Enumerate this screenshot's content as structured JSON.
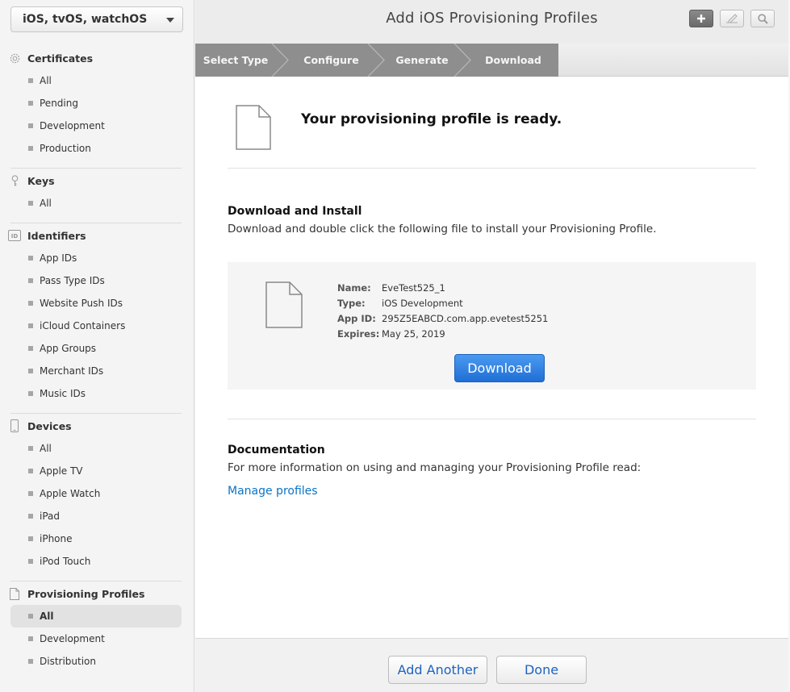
{
  "sidebar": {
    "platform": "iOS, tvOS, watchOS",
    "sections": {
      "certificates": {
        "title": "Certificates",
        "items": [
          "All",
          "Pending",
          "Development",
          "Production"
        ]
      },
      "keys": {
        "title": "Keys",
        "items": [
          "All"
        ]
      },
      "identifiers": {
        "title": "Identifiers",
        "items": [
          "App IDs",
          "Pass Type IDs",
          "Website Push IDs",
          "iCloud Containers",
          "App Groups",
          "Merchant IDs",
          "Music IDs"
        ]
      },
      "devices": {
        "title": "Devices",
        "items": [
          "All",
          "Apple TV",
          "Apple Watch",
          "iPad",
          "iPhone",
          "iPod Touch"
        ]
      },
      "profiles": {
        "title": "Provisioning Profiles",
        "items": [
          "All",
          "Development",
          "Distribution"
        ],
        "active": "All"
      }
    }
  },
  "header": {
    "title": "Add iOS Provisioning Profiles"
  },
  "steps": [
    "Select Type",
    "Configure",
    "Generate",
    "Download"
  ],
  "main": {
    "ready_title": "Your provisioning profile is ready.",
    "install_heading": "Download and Install",
    "install_text": "Download and double click the following file to install your Provisioning Profile.",
    "profile": {
      "name_label": "Name:",
      "name": "EveTest525_1",
      "type_label": "Type:",
      "type": "iOS Development",
      "appid_label": "App ID:",
      "appid": "295Z5EABCD.com.app.evetest5251",
      "expires_label": "Expires:",
      "expires": "May 25, 2019"
    },
    "download_label": "Download",
    "doc_heading": "Documentation",
    "doc_text": "For more information on using and managing your Provisioning Profile read:",
    "doc_link": "Manage profiles"
  },
  "footer": {
    "add_another": "Add Another",
    "done": "Done"
  },
  "colors": {
    "accent": "#1f6fd6",
    "link": "#0a74c6",
    "step_bar": "#8e8e8e"
  }
}
